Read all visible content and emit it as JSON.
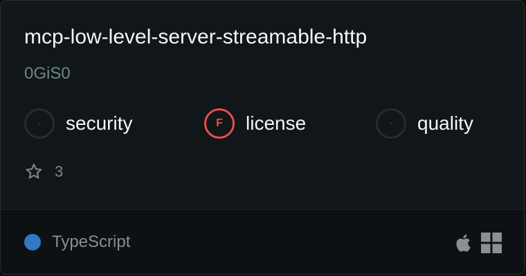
{
  "repo": {
    "name": "mcp-low-level-server-streamable-http",
    "owner": "0GiS0"
  },
  "scores": [
    {
      "label": "security",
      "grade": "-"
    },
    {
      "label": "license",
      "grade": "F"
    },
    {
      "label": "quality",
      "grade": "-"
    }
  ],
  "stars": {
    "count": "3",
    "icon": "star-outline-icon"
  },
  "footer": {
    "language": "TypeScript",
    "language_color": "#3178c6",
    "platforms": [
      "apple-icon",
      "windows-icon"
    ]
  },
  "colors": {
    "fail": "#f04a4f",
    "owner": "#6c8883"
  }
}
